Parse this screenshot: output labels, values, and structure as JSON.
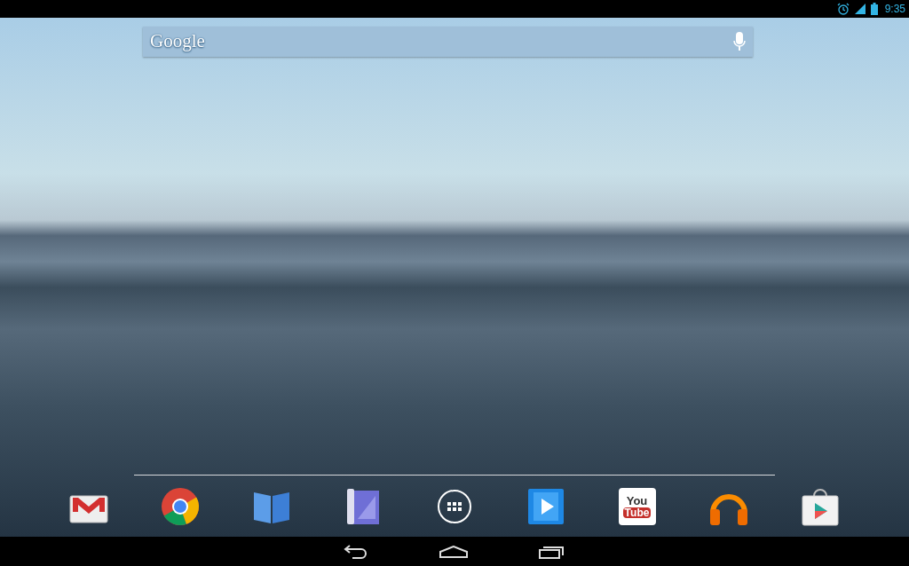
{
  "status_bar": {
    "time": "9:35"
  },
  "search_bar": {
    "logo": "Google"
  },
  "dock": [
    {
      "kind": "mail"
    },
    {
      "kind": "browser"
    },
    {
      "kind": "book"
    },
    {
      "kind": "magazine"
    },
    {
      "kind": "apps"
    },
    {
      "kind": "video"
    },
    {
      "kind": "youtube",
      "line_1": "You",
      "line_2": "Tube"
    },
    {
      "kind": "music"
    },
    {
      "kind": "store"
    }
  ]
}
